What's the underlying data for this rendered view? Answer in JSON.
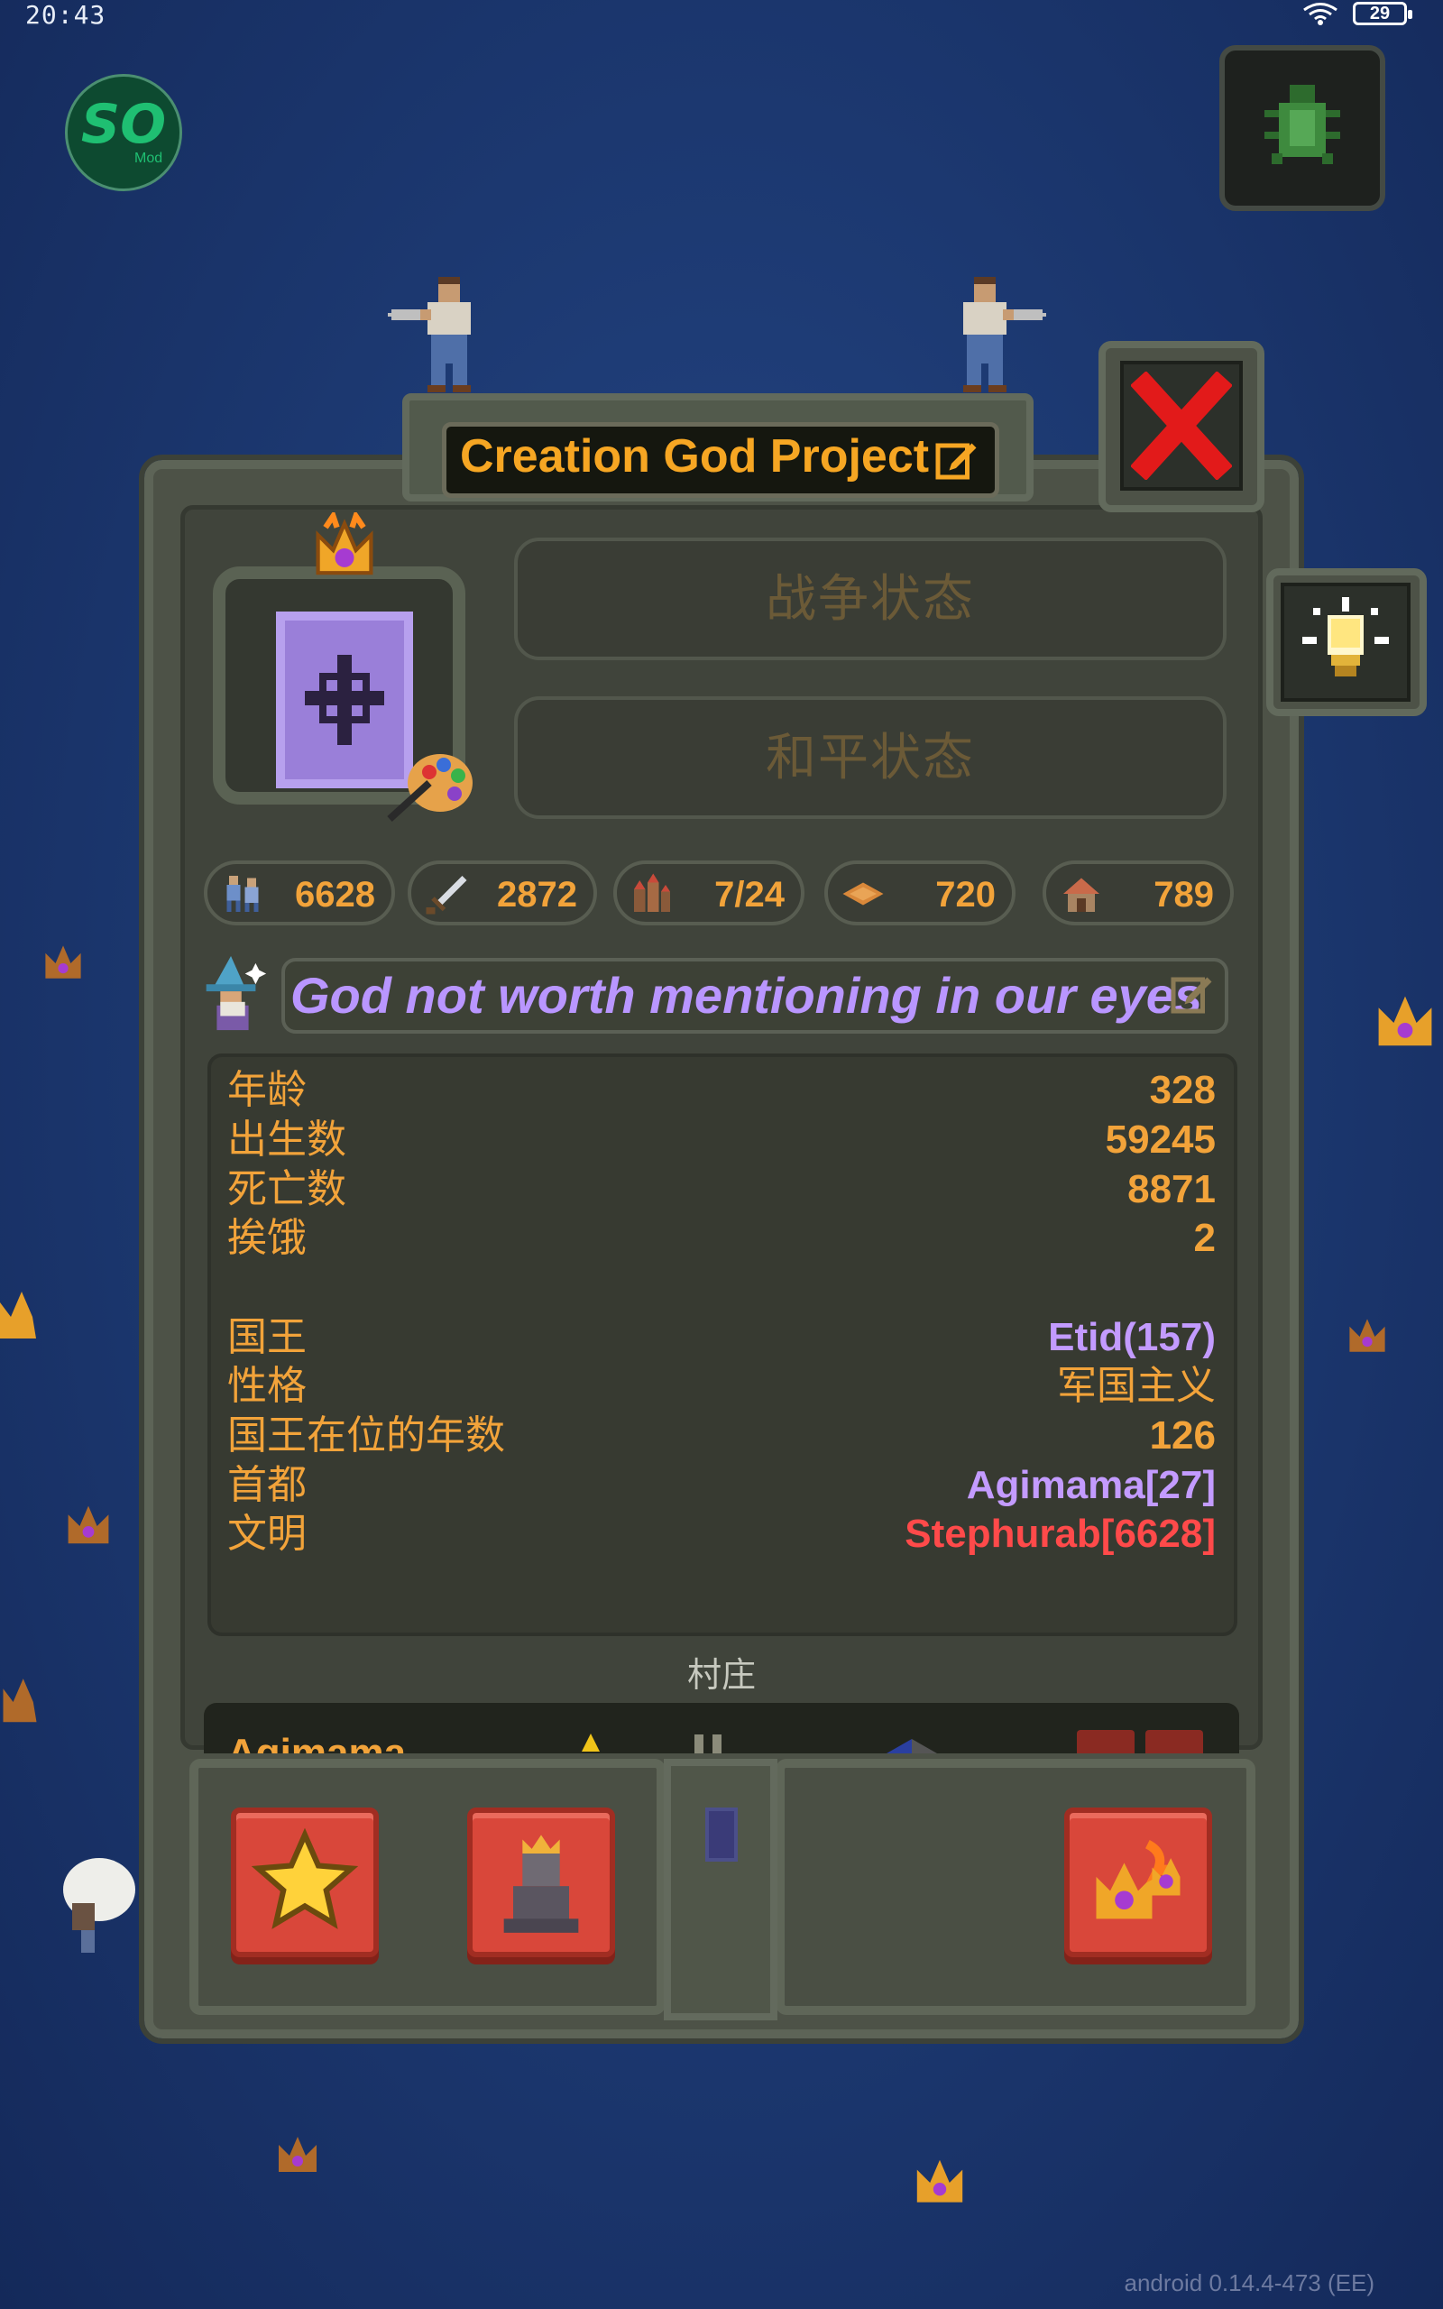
{
  "status_bar": {
    "time": "20:43",
    "battery": "29"
  },
  "logo": {
    "text": "SO",
    "sub": "Mod"
  },
  "kingdom": {
    "name": "Creation God Project",
    "war_state_label": "战争状态",
    "peace_state_label": "和平状态",
    "motto": "God not worth mentioning in our eyes"
  },
  "stats": {
    "population": "6628",
    "army": "2872",
    "cities": "7/24",
    "territory": "720",
    "buildings": "789"
  },
  "info": {
    "age_label": "年龄",
    "age_value": "328",
    "births_label": "出生数",
    "births_value": "59245",
    "deaths_label": "死亡数",
    "deaths_value": "8871",
    "starving_label": "挨饿",
    "starving_value": "2",
    "king_label": "国王",
    "king_value": "Etid(157)",
    "personality_label": "性格",
    "personality_value": "军国主义",
    "king_years_label": "国王在位的年数",
    "king_years_value": "126",
    "capital_label": "首都",
    "capital_value": "Agimama[27]",
    "culture_label": "文明",
    "culture_value": "Stephurab[6628]"
  },
  "villages": {
    "title": "村庄",
    "first_name": "Agimama"
  },
  "version": "android 0.14.4-473 (EE)",
  "colors": {
    "accent_orange": "#f2a33a",
    "motto_purple": "#b996ff",
    "king_purple": "#c39bff",
    "culture_red": "#ff4a4a",
    "button_red": "#d9473a",
    "background_blue": "#1d3a73"
  }
}
